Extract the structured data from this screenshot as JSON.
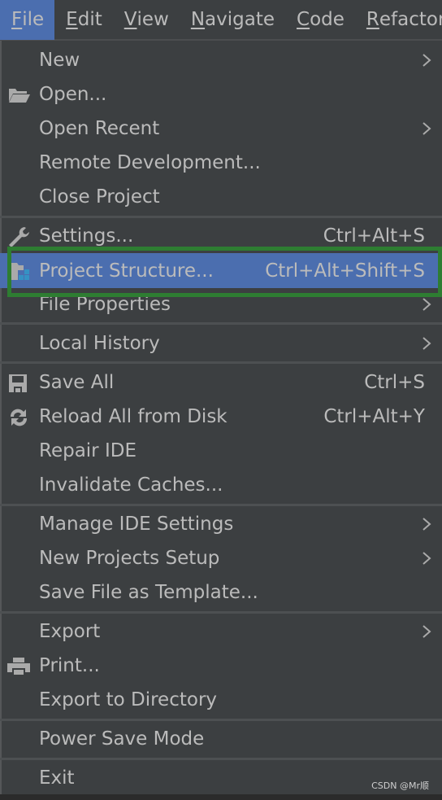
{
  "menubar": {
    "items": [
      {
        "label": "File",
        "mnemonic": "F",
        "active": true
      },
      {
        "label": "Edit",
        "mnemonic": "E"
      },
      {
        "label": "View",
        "mnemonic": "V"
      },
      {
        "label": "Navigate",
        "mnemonic": "N"
      },
      {
        "label": "Code",
        "mnemonic": "C"
      },
      {
        "label": "Refactor",
        "mnemonic": "R"
      }
    ]
  },
  "file_menu": {
    "items": [
      {
        "label": "New",
        "submenu": true
      },
      {
        "label": "Open...",
        "icon": "folder-open-icon"
      },
      {
        "label": "Open Recent",
        "submenu": true
      },
      {
        "label": "Remote Development..."
      },
      {
        "label": "Close Project"
      },
      {
        "label": "Settings...",
        "icon": "wrench-icon",
        "shortcut": "Ctrl+Alt+S"
      },
      {
        "label": "Project Structure...",
        "icon": "project-structure-icon",
        "shortcut": "Ctrl+Alt+Shift+S",
        "selected": true
      },
      {
        "label": "File Properties",
        "submenu": true
      },
      {
        "label": "Local History",
        "submenu": true
      },
      {
        "label": "Save All",
        "icon": "save-icon",
        "shortcut": "Ctrl+S"
      },
      {
        "label": "Reload All from Disk",
        "icon": "reload-icon",
        "shortcut": "Ctrl+Alt+Y"
      },
      {
        "label": "Repair IDE"
      },
      {
        "label": "Invalidate Caches..."
      },
      {
        "label": "Manage IDE Settings",
        "submenu": true
      },
      {
        "label": "New Projects Setup",
        "submenu": true
      },
      {
        "label": "Save File as Template..."
      },
      {
        "label": "Export",
        "submenu": true
      },
      {
        "label": "Print...",
        "icon": "printer-icon"
      },
      {
        "label": "Export to Directory"
      },
      {
        "label": "Power Save Mode"
      },
      {
        "label": "Exit"
      }
    ]
  },
  "colors": {
    "background": "#3c3f41",
    "selection": "#4b6eaf",
    "highlight_border": "#2e7d32",
    "text": "#bbbbbb"
  },
  "watermark": "CSDN @Mr顺"
}
